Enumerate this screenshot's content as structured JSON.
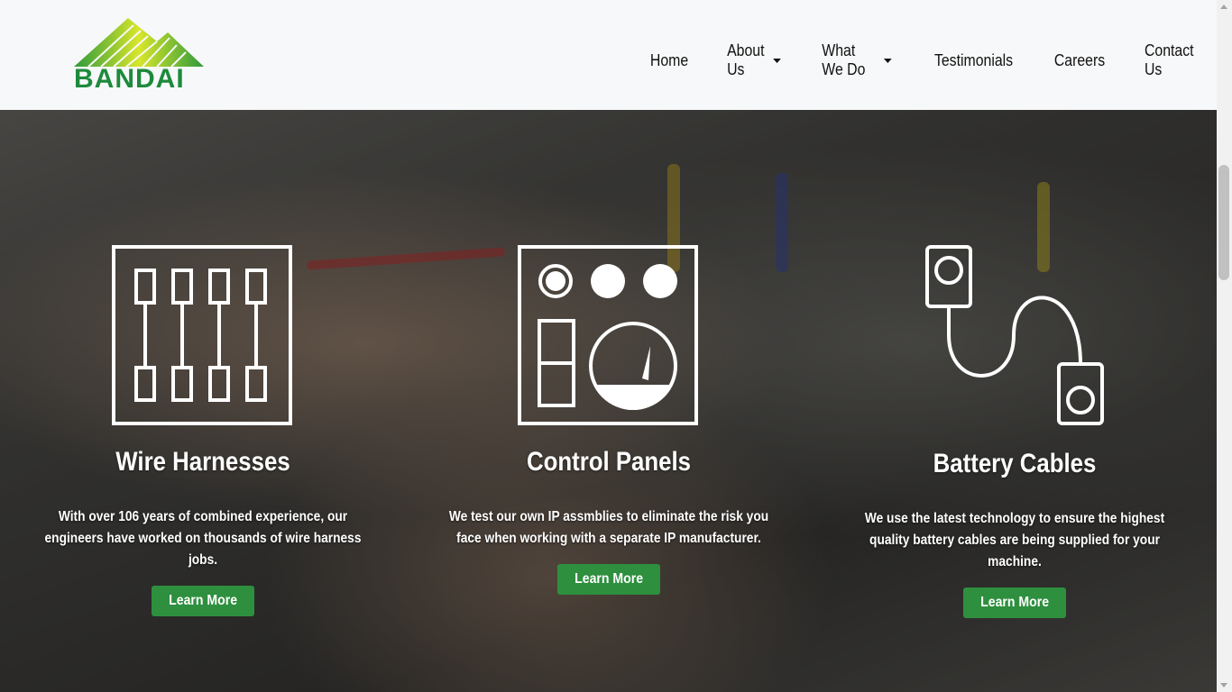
{
  "brand": {
    "name": "BANDAI",
    "green": "#1d8a3c"
  },
  "nav": {
    "home": "Home",
    "about": "About Us",
    "what_we_do": "What We Do",
    "testimonials": "Testimonials",
    "careers": "Careers",
    "contact": "Contact Us"
  },
  "services": [
    {
      "icon": "wire-harness-icon",
      "title": "Wire Harnesses",
      "text": "With over 106 years of combined experience, our engineers have worked on thousands of wire harness jobs.",
      "button": "Learn More"
    },
    {
      "icon": "control-panel-icon",
      "title": "Control Panels",
      "text": "We test our own IP assmblies to eliminate the risk you face when working with a separate IP manufacturer.",
      "button": "Learn More"
    },
    {
      "icon": "battery-cable-icon",
      "title": "Battery Cables",
      "text": "We use the latest technology to ensure the highest quality battery cables are being supplied for your machine.",
      "button": "Learn More"
    }
  ],
  "colors": {
    "button_green": "#2e8f3e",
    "navbar_bg": "#f7f8f9"
  }
}
